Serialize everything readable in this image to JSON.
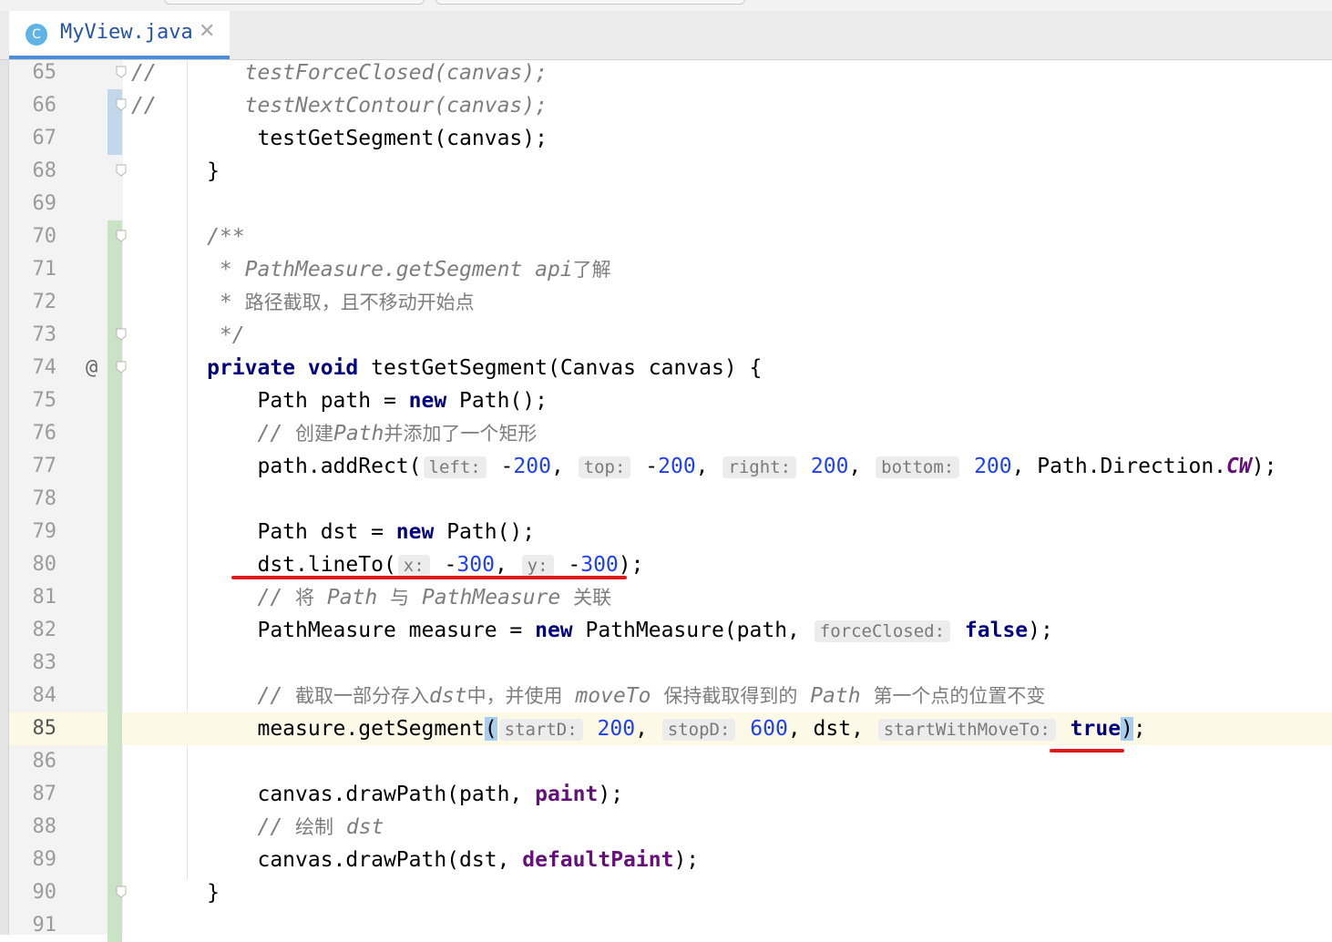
{
  "editor_tab": {
    "label": "MyView.java",
    "icon": "C",
    "close_glyph": "✕"
  },
  "code_lines": [
    {
      "n": "65",
      "tokens": [
        [
          "cm",
          "//       "
        ],
        [
          "cm",
          "testForceClosed(canvas);"
        ]
      ],
      "mark": "",
      "fold": true
    },
    {
      "n": "66",
      "tokens": [
        [
          "cm",
          "//       "
        ],
        [
          "cm",
          "testNextContour(canvas);"
        ]
      ],
      "mark": "",
      "fold": true
    },
    {
      "n": "67",
      "tokens": [
        [
          "t",
          "          testGetSegment(canvas);"
        ]
      ],
      "mark": "",
      "fold": false
    },
    {
      "n": "68",
      "tokens": [
        [
          "t",
          "      }"
        ]
      ],
      "mark": "",
      "fold": true
    },
    {
      "n": "69",
      "tokens": [],
      "mark": "",
      "fold": false
    },
    {
      "n": "70",
      "tokens": [
        [
          "cm",
          "      /**"
        ]
      ],
      "mark": "",
      "fold": true
    },
    {
      "n": "71",
      "tokens": [
        [
          "cm",
          "       * PathMeasure.getSegment api"
        ],
        [
          "cmcn",
          "了解"
        ]
      ],
      "mark": "",
      "fold": false
    },
    {
      "n": "72",
      "tokens": [
        [
          "cm",
          "       * "
        ],
        [
          "cmcn",
          "路径截取，且不移动开始点"
        ]
      ],
      "mark": "",
      "fold": false
    },
    {
      "n": "73",
      "tokens": [
        [
          "cm",
          "       */"
        ]
      ],
      "mark": "",
      "fold": true
    },
    {
      "n": "74",
      "tokens": [
        [
          "t",
          "      "
        ],
        [
          "kw",
          "private"
        ],
        [
          "t",
          " "
        ],
        [
          "kw",
          "void"
        ],
        [
          "t",
          " testGetSegment(Canvas canvas) {"
        ]
      ],
      "mark": "@",
      "fold": true
    },
    {
      "n": "75",
      "tokens": [
        [
          "t",
          "          Path path = "
        ],
        [
          "kw",
          "new"
        ],
        [
          "t",
          " Path();"
        ]
      ],
      "mark": "",
      "fold": false
    },
    {
      "n": "76",
      "tokens": [
        [
          "cm",
          "          // "
        ],
        [
          "cmcn",
          "创建"
        ],
        [
          "cm",
          "Path"
        ],
        [
          "cmcn",
          "并添加了一个矩形"
        ]
      ],
      "mark": "",
      "fold": false
    },
    {
      "n": "77",
      "tokens": [
        [
          "t",
          "          path.addRect("
        ],
        [
          "hint",
          "left:"
        ],
        [
          "t",
          " -"
        ],
        [
          "num",
          "200"
        ],
        [
          "t",
          ", "
        ],
        [
          "hint",
          "top:"
        ],
        [
          "t",
          " -"
        ],
        [
          "num",
          "200"
        ],
        [
          "t",
          ", "
        ],
        [
          "hint",
          "right:"
        ],
        [
          "t",
          " "
        ],
        [
          "num",
          "200"
        ],
        [
          "t",
          ", "
        ],
        [
          "hint",
          "bottom:"
        ],
        [
          "t",
          " "
        ],
        [
          "num",
          "200"
        ],
        [
          "t",
          ", Path.Direction."
        ],
        [
          "stfld",
          "CW"
        ],
        [
          "t",
          ");"
        ]
      ],
      "mark": "",
      "fold": false
    },
    {
      "n": "78",
      "tokens": [],
      "mark": "",
      "fold": false
    },
    {
      "n": "79",
      "tokens": [
        [
          "t",
          "          Path dst = "
        ],
        [
          "kw",
          "new"
        ],
        [
          "t",
          " Path();"
        ]
      ],
      "mark": "",
      "fold": false
    },
    {
      "n": "80",
      "tokens": [
        [
          "t",
          "          dst.lineTo("
        ],
        [
          "hint",
          "x:"
        ],
        [
          "t",
          " -"
        ],
        [
          "num",
          "300"
        ],
        [
          "t",
          ", "
        ],
        [
          "hint",
          "y:"
        ],
        [
          "t",
          " -"
        ],
        [
          "num",
          "300"
        ],
        [
          "t",
          ");"
        ]
      ],
      "mark": "",
      "fold": false
    },
    {
      "n": "81",
      "tokens": [
        [
          "cm",
          "          // "
        ],
        [
          "cmcn",
          "将"
        ],
        [
          "cm",
          " Path "
        ],
        [
          "cmcn",
          "与"
        ],
        [
          "cm",
          " PathMeasure "
        ],
        [
          "cmcn",
          "关联"
        ]
      ],
      "mark": "",
      "fold": false
    },
    {
      "n": "82",
      "tokens": [
        [
          "t",
          "          PathMeasure measure = "
        ],
        [
          "kw",
          "new"
        ],
        [
          "t",
          " PathMeasure(path, "
        ],
        [
          "hint",
          "forceClosed:"
        ],
        [
          "t",
          " "
        ],
        [
          "kw",
          "false"
        ],
        [
          "t",
          ");"
        ]
      ],
      "mark": "",
      "fold": false
    },
    {
      "n": "83",
      "tokens": [],
      "mark": "",
      "fold": false
    },
    {
      "n": "84",
      "tokens": [
        [
          "cm",
          "          // "
        ],
        [
          "cmcn",
          "截取一部分存入"
        ],
        [
          "cm",
          "dst"
        ],
        [
          "cmcn",
          "中，并使用"
        ],
        [
          "cm",
          " moveTo "
        ],
        [
          "cmcn",
          "保持截取得到的"
        ],
        [
          "cm",
          " Path "
        ],
        [
          "cmcn",
          "第一个点的位置不变"
        ]
      ],
      "mark": "",
      "fold": false
    },
    {
      "n": "85",
      "tokens": [
        [
          "t",
          "          measure.getSegment"
        ],
        [
          "brace",
          "("
        ],
        [
          "hint",
          "startD:"
        ],
        [
          "t",
          " "
        ],
        [
          "num",
          "200"
        ],
        [
          "t",
          ", "
        ],
        [
          "hint",
          "stopD:"
        ],
        [
          "t",
          " "
        ],
        [
          "num",
          "600"
        ],
        [
          "t",
          ", dst, "
        ],
        [
          "hint",
          "startWithMoveTo:"
        ],
        [
          "t",
          " "
        ],
        [
          "kw",
          "true"
        ],
        [
          "brace",
          ")"
        ],
        [
          "t",
          ";"
        ]
      ],
      "mark": "",
      "fold": false,
      "current": true
    },
    {
      "n": "86",
      "tokens": [],
      "mark": "",
      "fold": false
    },
    {
      "n": "87",
      "tokens": [
        [
          "t",
          "          canvas.drawPath(path, "
        ],
        [
          "fld",
          "paint"
        ],
        [
          "t",
          ");"
        ]
      ],
      "mark": "",
      "fold": false
    },
    {
      "n": "88",
      "tokens": [
        [
          "cm",
          "          // "
        ],
        [
          "cmcn",
          "绘制"
        ],
        [
          "cm",
          " dst"
        ]
      ],
      "mark": "",
      "fold": false
    },
    {
      "n": "89",
      "tokens": [
        [
          "t",
          "          canvas.drawPath(dst, "
        ],
        [
          "fld",
          "defaultPaint"
        ],
        [
          "t",
          ");"
        ]
      ],
      "mark": "",
      "fold": false
    },
    {
      "n": "90",
      "tokens": [
        [
          "t",
          "      }"
        ]
      ],
      "mark": "",
      "fold": true
    },
    {
      "n": "91",
      "tokens": [],
      "mark": "",
      "fold": false
    }
  ],
  "colors": {
    "keyword": "#000080",
    "number": "#1c3fff",
    "comment": "#7d7d7d",
    "field": "#660e7a",
    "annotation_underline": "#e01a1a",
    "current_line": "#fcfae6"
  }
}
